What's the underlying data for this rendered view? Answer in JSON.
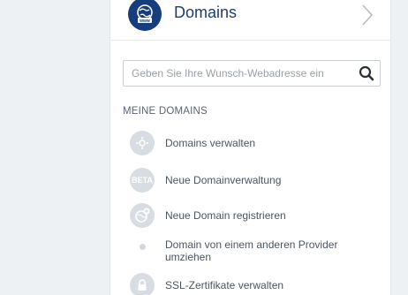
{
  "header": {
    "title": "Domains",
    "icon": "globe-www-icon",
    "accent_color": "#183d7c"
  },
  "search": {
    "placeholder": "Geben Sie Ihre Wunsch-Webadresse ein",
    "value": ""
  },
  "section": {
    "title": "MEINE DOMAINS"
  },
  "menu": {
    "items": [
      {
        "label": "Domains verwalten",
        "icon": "gear-globe-icon"
      },
      {
        "label": "Neue Domainverwaltung",
        "icon": "beta-badge-icon",
        "badge": "BETA"
      },
      {
        "label": "Neue Domain registrieren",
        "icon": "globe-plus-icon"
      },
      {
        "label": "Domain von einem anderen Provider umziehen",
        "icon": "bullet-icon"
      },
      {
        "label": "SSL-Zertifikate verwalten",
        "icon": "ssl-lock-icon"
      }
    ]
  }
}
